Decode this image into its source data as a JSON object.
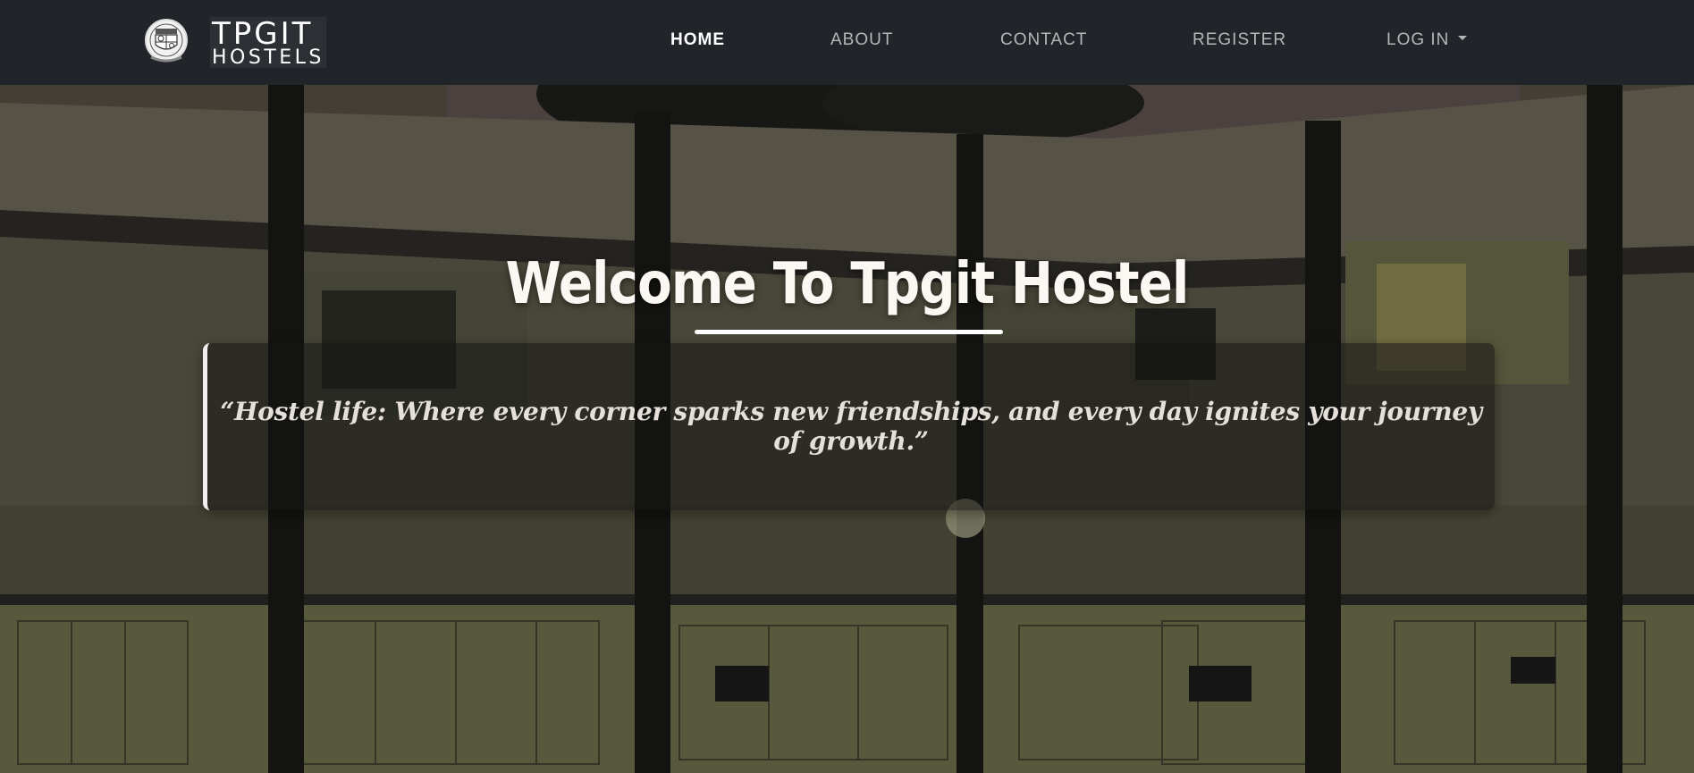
{
  "navbar": {
    "brand_top": "TPGIT",
    "brand_bottom": "HOSTELS",
    "links": [
      {
        "label": "HOME",
        "active": true
      },
      {
        "label": "ABOUT",
        "active": false
      },
      {
        "label": "CONTACT",
        "active": false
      },
      {
        "label": "REGISTER",
        "active": false
      },
      {
        "label": "LOG IN",
        "active": false,
        "has_dropdown": true
      }
    ],
    "dropdown_icon": "caret-down-icon",
    "logo_icon": "college-seal-icon"
  },
  "hero": {
    "title": "Welcome To Tpgit Hostel",
    "quote": "“Hostel life: Where every corner sparks new friendships, and every day ignites your journey of growth.”"
  },
  "colors": {
    "navbar_bg": "#212529",
    "nav_active": "#ffffff",
    "nav_inactive": "#b4b6b9",
    "title_color": "#fbf7f3",
    "quote_color": "#e5e0da"
  }
}
